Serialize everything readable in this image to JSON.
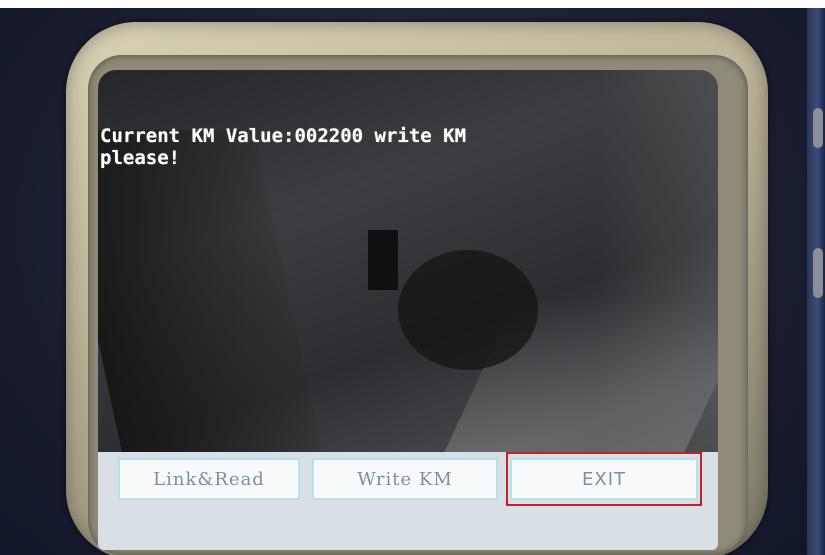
{
  "screen": {
    "message": "Current KM Value:002200 write KM\nplease!"
  },
  "buttons": {
    "link_read": "Link&Read",
    "write_km": "Write KM",
    "exit": "EXIT"
  },
  "colors": {
    "button_text": "#7f8ea4",
    "button_border": "#b9dfe7",
    "highlight": "#c3202a"
  }
}
